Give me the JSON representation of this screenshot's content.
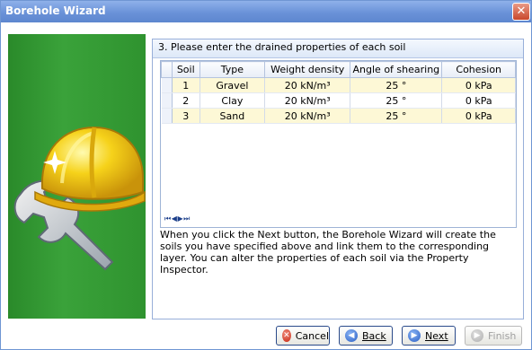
{
  "window": {
    "title": "Borehole Wizard",
    "close_glyph": "✕"
  },
  "step": {
    "title": "3. Please enter the drained properties of each soil"
  },
  "grid": {
    "columns": [
      "Soil",
      "Type",
      "Weight density",
      "Angle of shearing",
      "Cohesion"
    ],
    "rows": [
      [
        "1",
        "Gravel",
        "20 kN/m³",
        "25 °",
        "0 kPa"
      ],
      [
        "2",
        "Clay",
        "20 kN/m³",
        "25 °",
        "0 kPa"
      ],
      [
        "3",
        "Sand",
        "20 kN/m³",
        "25 °",
        "0 kPa"
      ]
    ],
    "nav_glyphs": "⏮ ◀ ▶ ⏭"
  },
  "description": "When you click the Next button, the Borehole Wizard will create the soils you have specified above and link them to the corresponding layer. You can alter the properties of each soil via the Property Inspector.",
  "buttons": {
    "cancel": "Cancel",
    "back": "Back",
    "next": "Next",
    "finish": "Finish"
  },
  "icons": {
    "cancel": "x-circle-icon",
    "back": "arrow-left-circle-icon",
    "next": "arrow-right-circle-icon",
    "finish": "arrow-right-circle-icon"
  }
}
